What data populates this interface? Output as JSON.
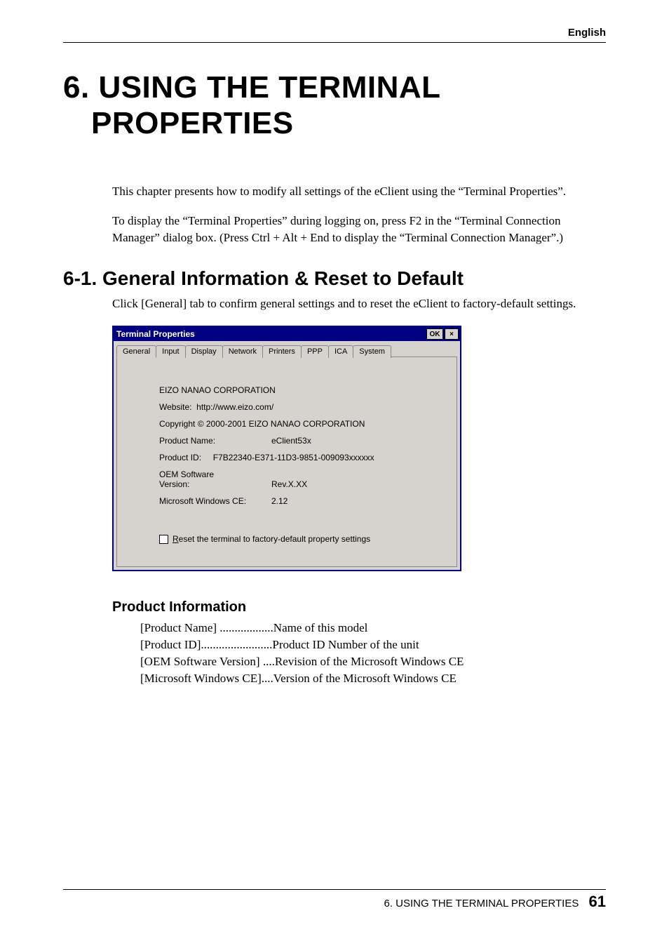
{
  "header": {
    "language": "English"
  },
  "title": {
    "prefix": "6.",
    "line1": "USING THE TERMINAL",
    "line2": "PROPERTIES"
  },
  "intro": {
    "p1": "This chapter presents how to modify all settings of the eClient using the “Terminal Properties”.",
    "p2": "To display the “Terminal Properties” during logging on, press F2 in the “Terminal Connection Manager” dialog box.  (Press Ctrl + Alt + End to display the “Terminal Connection Manager”.)"
  },
  "section": {
    "heading": "6-1. General Information & Reset to Default",
    "desc": "Click [General] tab to confirm general settings and to reset the eClient to factory-default settings."
  },
  "dialog": {
    "title": "Terminal Properties",
    "ok": "OK",
    "close": "×",
    "tabs": [
      "General",
      "Input",
      "Display",
      "Network",
      "Printers",
      "PPP",
      "ICA",
      "System"
    ],
    "active_tab": 0,
    "content": {
      "company": "EIZO NANAO CORPORATION",
      "website_label": "Website:",
      "website_value": "http://www.eizo.com/",
      "copyright": "Copyright © 2000-2001 EIZO NANAO CORPORATION",
      "product_name_label": "Product Name:",
      "product_name_value": "eClient53x",
      "product_id_label": "Product ID:",
      "product_id_value": "F7B22340-E371-11D3-9851-009093xxxxxx",
      "oem_label_1": "OEM Software",
      "oem_label_2": "Version:",
      "oem_value": "Rev.X.XX",
      "wince_label": "Microsoft Windows CE:",
      "wince_value": "2.12",
      "reset_prefix": "R",
      "reset_rest": "eset the terminal to factory-default property settings"
    }
  },
  "subheading": "Product Information",
  "definitions": {
    "l1": "[Product Name] ..................Name of this model",
    "l2": "[Product ID]........................Product ID Number of the unit",
    "l3": "[OEM Software Version] ....Revision of the Microsoft Windows CE",
    "l4": "[Microsoft Windows CE]....Version of the Microsoft Windows CE"
  },
  "footer": {
    "text": "6. USING THE TERMINAL PROPERTIES",
    "page": "61"
  }
}
